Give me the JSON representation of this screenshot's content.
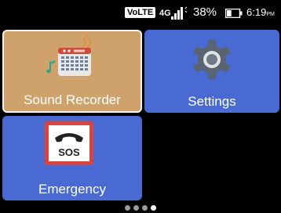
{
  "status_bar": {
    "volte": "VoLTE",
    "network": "4G",
    "battery_percent": "38%",
    "battery_level": 0.38,
    "time": "6:19",
    "ampm": "PM"
  },
  "apps": [
    {
      "label": "Sound Recorder",
      "icon": "sound-recorder-icon",
      "color": "#cfa26b"
    },
    {
      "label": "Settings",
      "icon": "gear-icon",
      "color": "#4a6ad3"
    },
    {
      "label": "Emergency",
      "icon": "sos-phone-icon",
      "color": "#4a6ad3"
    }
  ],
  "pager": {
    "pages": 4,
    "current": 4
  }
}
